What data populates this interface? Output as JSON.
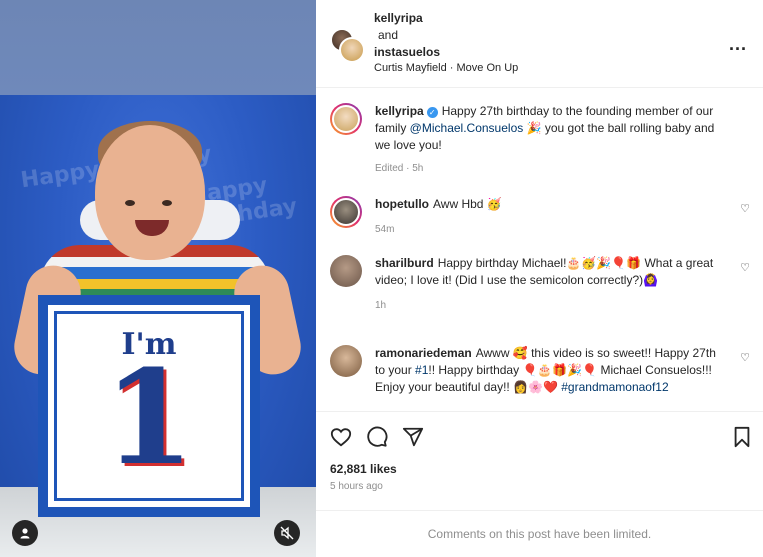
{
  "header": {
    "user1": "kellyripa",
    "and_label": "and",
    "user2": "instasuelos",
    "audio": "Curtis Mayfield · Move On Up",
    "more_label": "..."
  },
  "media": {
    "sign_text_top": "I'm",
    "sign_text_number": "1",
    "background_words": "Happy Birthday"
  },
  "caption": {
    "username": "kellyripa",
    "text_before": "Happy 27th birthday to the founding member of our family ",
    "mention": "@Michael.Consuelos",
    "text_after": " 🎉 you got the ball rolling baby and we love you!",
    "meta": "Edited · 5h"
  },
  "comments": [
    {
      "username": "hopetullo",
      "text": "Aww Hbd 🥳",
      "meta": "54m"
    },
    {
      "username": "sharilburd",
      "text": "Happy birthday Michael!🎂🥳🎉🎈🎁 What a great video; I love it! (Did I use the semicolon correctly?)🙆‍♀️",
      "meta": "1h"
    },
    {
      "username": "ramonariedeman",
      "text_before": "Awww 🥰 this video is so sweet!! Happy 27th to your ",
      "hashtag1": "#1",
      "text_after": "!! Happy birthday 🎈🎂🎁🎉🎈 Michael Consuelos!!! Enjoy your beautiful day!! 👩🌸❤️ ",
      "hashtag2": "#grandmamonaof12"
    }
  ],
  "likes": "62,881 likes",
  "posted": "5 hours ago",
  "footer": "Comments on this post have been limited.",
  "icons": {
    "like": "heart-icon",
    "comment": "comment-icon",
    "share": "send-icon",
    "save": "bookmark-icon",
    "mute": "muted-speaker-icon",
    "tags": "person-icon"
  },
  "colors": {
    "link": "#00376b",
    "verified": "#3897f0",
    "muted_text": "#8e8e8e"
  }
}
